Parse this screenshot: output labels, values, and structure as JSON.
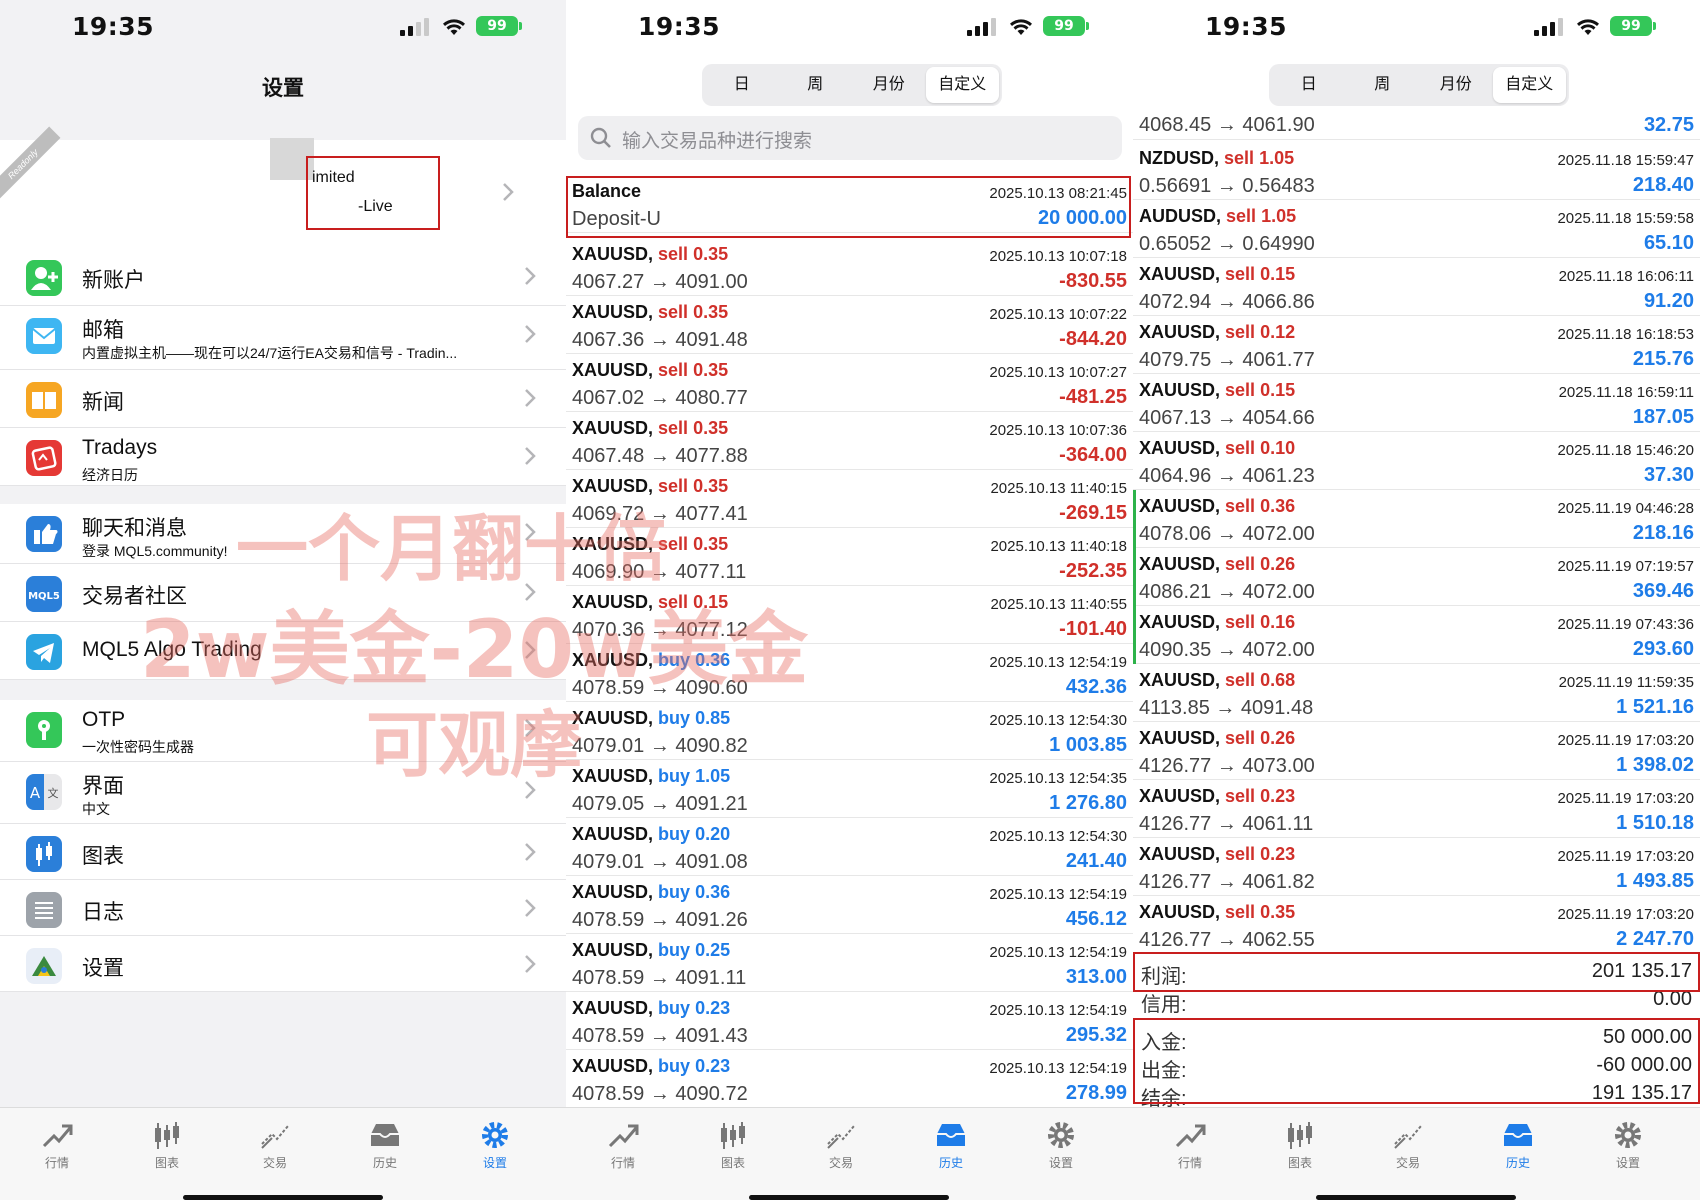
{
  "status": {
    "time": "19:35",
    "battery": "99"
  },
  "settings": {
    "title": "设置",
    "readonly_badge": "Readonly",
    "account_line1": "imited",
    "account_line2": "-Live",
    "items": [
      {
        "label": "新账户",
        "sub": "",
        "icon": "add-contact-icon",
        "color": "#34c759"
      },
      {
        "label": "邮箱",
        "sub": "内置虚拟主机——现在可以24/7运行EA交易和信号 - Tradin...",
        "icon": "mail-icon",
        "color": "#3eb6f2"
      },
      {
        "label": "新闻",
        "sub": "",
        "icon": "book-icon",
        "color": "#f6a623"
      },
      {
        "label": "Tradays",
        "sub": "经济日历",
        "icon": "calendar-icon",
        "color": "#e53935"
      },
      {
        "label": "聊天和消息",
        "sub": "登录 MQL5.community!",
        "icon": "chat-icon",
        "color": "#2b7fd9"
      },
      {
        "label": "交易者社区",
        "sub": "",
        "icon": "mql5-icon",
        "color": "#2b7fd9"
      },
      {
        "label": "MQL5 Algo Trading",
        "sub": "",
        "icon": "telegram-icon",
        "color": "#2aa3e0"
      },
      {
        "label": "OTP",
        "sub": "一次性密码生成器",
        "icon": "lock-icon",
        "color": "#34c759"
      },
      {
        "label": "界面",
        "sub": "中文",
        "icon": "translate-icon",
        "color": "#2b7fd9"
      },
      {
        "label": "图表",
        "sub": "",
        "icon": "candles-icon",
        "color": "#2b7fd9"
      },
      {
        "label": "日志",
        "sub": "",
        "icon": "list-icon",
        "color": "#9da3aa"
      },
      {
        "label": "设置",
        "sub": "",
        "icon": "settings-app-icon",
        "color": "#4a90e2"
      }
    ]
  },
  "tabs": [
    "行情",
    "图表",
    "交易",
    "历史",
    "设置"
  ],
  "segments": [
    "日",
    "周",
    "月份",
    "自定义"
  ],
  "search_placeholder": "输入交易品种进行搜索",
  "history_oct": {
    "balance": {
      "title": "Balance",
      "sub": "Deposit-U",
      "date": "2025.10.13 08:21:45",
      "amount": "20 000.00"
    },
    "trades": [
      {
        "symbol": "XAUUSD,",
        "side": "sell",
        "lots": "0.35",
        "prices": "4067.27 → 4091.00",
        "date": "2025.10.13 10:07:18",
        "pl": "-830.55"
      },
      {
        "symbol": "XAUUSD,",
        "side": "sell",
        "lots": "0.35",
        "prices": "4067.36 → 4091.48",
        "date": "2025.10.13 10:07:22",
        "pl": "-844.20"
      },
      {
        "symbol": "XAUUSD,",
        "side": "sell",
        "lots": "0.35",
        "prices": "4067.02 → 4080.77",
        "date": "2025.10.13 10:07:27",
        "pl": "-481.25"
      },
      {
        "symbol": "XAUUSD,",
        "side": "sell",
        "lots": "0.35",
        "prices": "4067.48 → 4077.88",
        "date": "2025.10.13 10:07:36",
        "pl": "-364.00"
      },
      {
        "symbol": "XAUUSD,",
        "side": "sell",
        "lots": "0.35",
        "prices": "4069.72 → 4077.41",
        "date": "2025.10.13 11:40:15",
        "pl": "-269.15"
      },
      {
        "symbol": "XAUUSD,",
        "side": "sell",
        "lots": "0.35",
        "prices": "4069.90 → 4077.11",
        "date": "2025.10.13 11:40:18",
        "pl": "-252.35"
      },
      {
        "symbol": "XAUUSD,",
        "side": "sell",
        "lots": "0.15",
        "prices": "4070.36 → 4077.12",
        "date": "2025.10.13 11:40:55",
        "pl": "-101.40"
      },
      {
        "symbol": "XAUUSD,",
        "side": "buy",
        "lots": "0.36",
        "prices": "4078.59 → 4090.60",
        "date": "2025.10.13 12:54:19",
        "pl": "432.36"
      },
      {
        "symbol": "XAUUSD,",
        "side": "buy",
        "lots": "0.85",
        "prices": "4079.01 → 4090.82",
        "date": "2025.10.13 12:54:30",
        "pl": "1 003.85"
      },
      {
        "symbol": "XAUUSD,",
        "side": "buy",
        "lots": "1.05",
        "prices": "4079.05 → 4091.21",
        "date": "2025.10.13 12:54:35",
        "pl": "1 276.80"
      },
      {
        "symbol": "XAUUSD,",
        "side": "buy",
        "lots": "0.20",
        "prices": "4079.01 → 4091.08",
        "date": "2025.10.13 12:54:30",
        "pl": "241.40"
      },
      {
        "symbol": "XAUUSD,",
        "side": "buy",
        "lots": "0.36",
        "prices": "4078.59 → 4091.26",
        "date": "2025.10.13 12:54:19",
        "pl": "456.12"
      },
      {
        "symbol": "XAUUSD,",
        "side": "buy",
        "lots": "0.25",
        "prices": "4078.59 → 4091.11",
        "date": "2025.10.13 12:54:19",
        "pl": "313.00"
      },
      {
        "symbol": "XAUUSD,",
        "side": "buy",
        "lots": "0.23",
        "prices": "4078.59 → 4091.43",
        "date": "2025.10.13 12:54:19",
        "pl": "295.32"
      },
      {
        "symbol": "XAUUSD,",
        "side": "buy",
        "lots": "0.23",
        "prices": "4078.59 → 4090.72",
        "date": "2025.10.13 12:54:19",
        "pl": "278.99"
      }
    ]
  },
  "history_nov": {
    "top_partial": {
      "prices": "4068.45 → 4061.90",
      "pl": "32.75"
    },
    "trades": [
      {
        "symbol": "NZDUSD,",
        "side": "sell",
        "lots": "1.05",
        "prices": "0.56691 → 0.56483",
        "date": "2025.11.18 15:59:47",
        "pl": "218.40"
      },
      {
        "symbol": "AUDUSD,",
        "side": "sell",
        "lots": "1.05",
        "prices": "0.65052 → 0.64990",
        "date": "2025.11.18 15:59:58",
        "pl": "65.10"
      },
      {
        "symbol": "XAUUSD,",
        "side": "sell",
        "lots": "0.15",
        "prices": "4072.94 → 4066.86",
        "date": "2025.11.18 16:06:11",
        "pl": "91.20"
      },
      {
        "symbol": "XAUUSD,",
        "side": "sell",
        "lots": "0.12",
        "prices": "4079.75 → 4061.77",
        "date": "2025.11.18 16:18:53",
        "pl": "215.76"
      },
      {
        "symbol": "XAUUSD,",
        "side": "sell",
        "lots": "0.15",
        "prices": "4067.13 → 4054.66",
        "date": "2025.11.18 16:59:11",
        "pl": "187.05"
      },
      {
        "symbol": "XAUUSD,",
        "side": "sell",
        "lots": "0.10",
        "prices": "4064.96 → 4061.23",
        "date": "2025.11.18 15:46:20",
        "pl": "37.30"
      },
      {
        "symbol": "XAUUSD,",
        "side": "sell",
        "lots": "0.36",
        "prices": "4078.06 → 4072.00",
        "date": "2025.11.19 04:46:28",
        "pl": "218.16"
      },
      {
        "symbol": "XAUUSD,",
        "side": "sell",
        "lots": "0.26",
        "prices": "4086.21 → 4072.00",
        "date": "2025.11.19 07:19:57",
        "pl": "369.46"
      },
      {
        "symbol": "XAUUSD,",
        "side": "sell",
        "lots": "0.16",
        "prices": "4090.35 → 4072.00",
        "date": "2025.11.19 07:43:36",
        "pl": "293.60"
      },
      {
        "symbol": "XAUUSD,",
        "side": "sell",
        "lots": "0.68",
        "prices": "4113.85 → 4091.48",
        "date": "2025.11.19 11:59:35",
        "pl": "1 521.16"
      },
      {
        "symbol": "XAUUSD,",
        "side": "sell",
        "lots": "0.26",
        "prices": "4126.77 → 4073.00",
        "date": "2025.11.19 17:03:20",
        "pl": "1 398.02"
      },
      {
        "symbol": "XAUUSD,",
        "side": "sell",
        "lots": "0.23",
        "prices": "4126.77 → 4061.11",
        "date": "2025.11.19 17:03:20",
        "pl": "1 510.18"
      },
      {
        "symbol": "XAUUSD,",
        "side": "sell",
        "lots": "0.23",
        "prices": "4126.77 → 4061.82",
        "date": "2025.11.19 17:03:20",
        "pl": "1 493.85"
      },
      {
        "symbol": "XAUUSD,",
        "side": "sell",
        "lots": "0.35",
        "prices": "4126.77 → 4062.55",
        "date": "2025.11.19 17:03:20",
        "pl": "2 247.70"
      }
    ],
    "summary": [
      {
        "label": "利润:",
        "value": "201 135.17"
      },
      {
        "label": "信用:",
        "value": "0.00"
      },
      {
        "label": "入金:",
        "value": "50 000.00"
      },
      {
        "label": "出金:",
        "value": "-60 000.00"
      },
      {
        "label": "结余:",
        "value": "191 135.17"
      }
    ]
  },
  "overlay_text": [
    "一个月翻十倍",
    "2w美金-20w美金",
    "可观摩"
  ],
  "colors": {
    "sell": "#d0302a",
    "buy": "#1e7ce8",
    "accent": "#1e7ce8",
    "highlight_box": "#c81e1e"
  }
}
